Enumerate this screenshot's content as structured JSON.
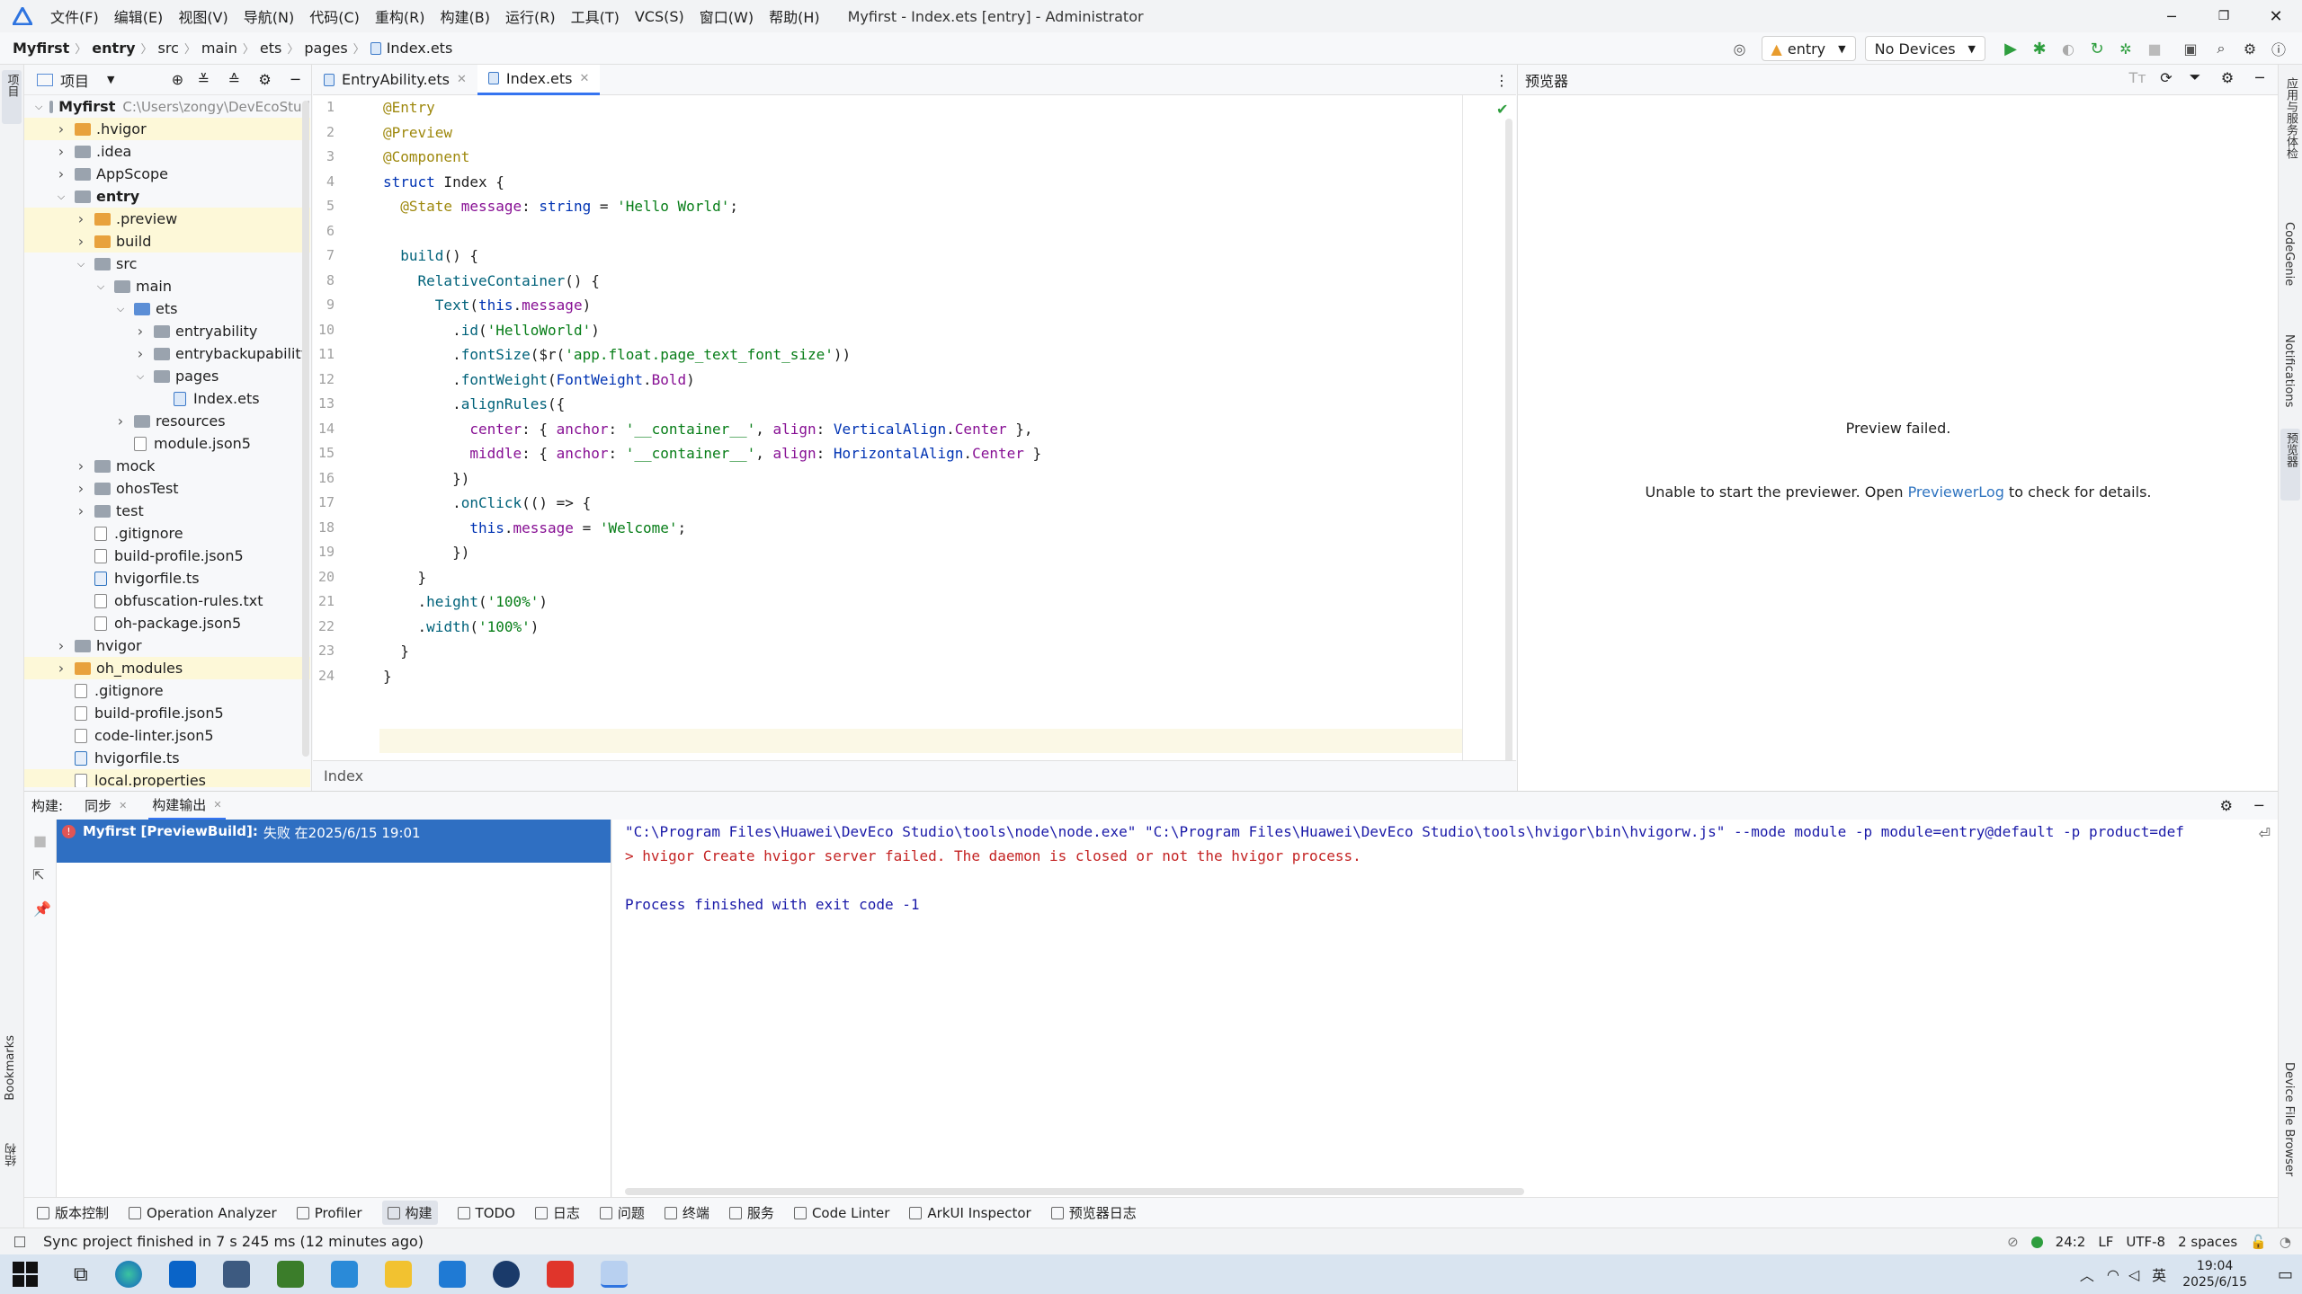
{
  "titlebar": {
    "menus": [
      "文件(F)",
      "编辑(E)",
      "视图(V)",
      "导航(N)",
      "代码(C)",
      "重构(R)",
      "构建(B)",
      "运行(R)",
      "工具(T)",
      "VCS(S)",
      "窗口(W)",
      "帮助(H)"
    ],
    "title": "Myfirst - Index.ets [entry] - Administrator"
  },
  "breadcrumb": [
    "Myfirst",
    "entry",
    "src",
    "main",
    "ets",
    "pages",
    "Index.ets"
  ],
  "toolbar": {
    "module": "entry",
    "device": "No Devices"
  },
  "leftstrip": {
    "project": "项目",
    "bookmarks": "Bookmarks",
    "structure": "结构"
  },
  "rightstrip": {
    "appservice": "应用与服务体检",
    "codegenie": "CodeGenie",
    "notifications": "Notifications",
    "previewer": "预览器",
    "devicefiles": "Device File Browser"
  },
  "project": {
    "header": "项目",
    "tree": [
      {
        "label": "Myfirst",
        "path": "C:\\Users\\zongy\\DevEcoStud",
        "depth": 0,
        "type": "root",
        "chev": "open"
      },
      {
        "label": ".hvigor",
        "depth": 1,
        "type": "folder-orange",
        "chev": "closed",
        "hl": true
      },
      {
        "label": ".idea",
        "depth": 1,
        "type": "folder",
        "chev": "closed"
      },
      {
        "label": "AppScope",
        "depth": 1,
        "type": "folder",
        "chev": "closed"
      },
      {
        "label": "entry",
        "depth": 1,
        "type": "folder",
        "chev": "open",
        "bold": true
      },
      {
        "label": ".preview",
        "depth": 2,
        "type": "folder-orange",
        "chev": "closed",
        "hl": true
      },
      {
        "label": "build",
        "depth": 2,
        "type": "folder-orange",
        "chev": "closed",
        "hl": true
      },
      {
        "label": "src",
        "depth": 2,
        "type": "folder",
        "chev": "open"
      },
      {
        "label": "main",
        "depth": 3,
        "type": "folder",
        "chev": "open"
      },
      {
        "label": "ets",
        "depth": 4,
        "type": "folder-blue",
        "chev": "open"
      },
      {
        "label": "entryability",
        "depth": 5,
        "type": "folder",
        "chev": "closed"
      },
      {
        "label": "entrybackupability",
        "depth": 5,
        "type": "folder",
        "chev": "closed"
      },
      {
        "label": "pages",
        "depth": 5,
        "type": "folder",
        "chev": "open"
      },
      {
        "label": "Index.ets",
        "depth": 6,
        "type": "ets",
        "chev": ""
      },
      {
        "label": "resources",
        "depth": 4,
        "type": "folder",
        "chev": "closed"
      },
      {
        "label": "module.json5",
        "depth": 4,
        "type": "json",
        "chev": ""
      },
      {
        "label": "mock",
        "depth": 2,
        "type": "folder",
        "chev": "closed"
      },
      {
        "label": "ohosTest",
        "depth": 2,
        "type": "folder",
        "chev": "closed"
      },
      {
        "label": "test",
        "depth": 2,
        "type": "folder",
        "chev": "closed"
      },
      {
        "label": ".gitignore",
        "depth": 2,
        "type": "json",
        "chev": ""
      },
      {
        "label": "build-profile.json5",
        "depth": 2,
        "type": "json",
        "chev": ""
      },
      {
        "label": "hvigorfile.ts",
        "depth": 2,
        "type": "ts",
        "chev": ""
      },
      {
        "label": "obfuscation-rules.txt",
        "depth": 2,
        "type": "json",
        "chev": ""
      },
      {
        "label": "oh-package.json5",
        "depth": 2,
        "type": "json",
        "chev": ""
      },
      {
        "label": "hvigor",
        "depth": 1,
        "type": "folder",
        "chev": "closed"
      },
      {
        "label": "oh_modules",
        "depth": 1,
        "type": "folder-orange",
        "chev": "closed",
        "hl": true
      },
      {
        "label": ".gitignore",
        "depth": 1,
        "type": "json",
        "chev": ""
      },
      {
        "label": "build-profile.json5",
        "depth": 1,
        "type": "json",
        "chev": ""
      },
      {
        "label": "code-linter.json5",
        "depth": 1,
        "type": "json",
        "chev": ""
      },
      {
        "label": "hvigorfile.ts",
        "depth": 1,
        "type": "ts",
        "chev": ""
      },
      {
        "label": "local.properties",
        "depth": 1,
        "type": "json",
        "chev": "",
        "hl": true
      }
    ]
  },
  "editor": {
    "tabs": [
      {
        "label": "EntryAbility.ets"
      },
      {
        "label": "Index.ets"
      }
    ],
    "footer": "Index",
    "lines": [
      "@Entry",
      "@Preview",
      "@Component",
      "struct Index {",
      "  @State message: string = 'Hello World';",
      "",
      "  build() {",
      "    RelativeContainer() {",
      "      Text(this.message)",
      "        .id('HelloWorld')",
      "        .fontSize($r('app.float.page_text_font_size'))",
      "        .fontWeight(FontWeight.Bold)",
      "        .alignRules({",
      "          center: { anchor: '__container__', align: VerticalAlign.Center },",
      "          middle: { anchor: '__container__', align: HorizontalAlign.Center }",
      "        })",
      "        .onClick(() => {",
      "          this.message = 'Welcome';",
      "        })",
      "    }",
      "    .height('100%')",
      "    .width('100%')",
      "  }",
      "}"
    ]
  },
  "preview": {
    "header": "预览器",
    "failed": "Preview failed.",
    "msg_before": "Unable to start the previewer. Open ",
    "link": "PreviewerLog",
    "msg_after": " to check for details."
  },
  "build": {
    "label": "构建:",
    "tabs": [
      "同步",
      "构建输出"
    ],
    "item_title": "Myfirst [PreviewBuild]:",
    "item_status": "失败 在2025/6/15 19:01",
    "output": [
      "\"C:\\Program Files\\Huawei\\DevEco Studio\\tools\\node\\node.exe\" \"C:\\Program Files\\Huawei\\DevEco Studio\\tools\\hvigor\\bin\\hvigorw.js\" --mode module -p module=entry@default -p product=def",
      "> hvigor Create hvigor server failed. The daemon is closed or not the hvigor process.",
      "",
      "Process finished with exit code -1"
    ]
  },
  "tooltabs": [
    "版本控制",
    "Operation Analyzer",
    "Profiler",
    "构建",
    "TODO",
    "日志",
    "问题",
    "终端",
    "服务",
    "Code Linter",
    "ArkUI Inspector",
    "预览器日志"
  ],
  "status": {
    "message": "Sync project finished in 7 s 245 ms (12 minutes ago)",
    "position": "24:2",
    "lineend": "LF",
    "encoding": "UTF-8",
    "indent": "2 spaces"
  },
  "taskbar": {
    "lang": "英",
    "time": "19:04",
    "date": "2025/6/15"
  }
}
